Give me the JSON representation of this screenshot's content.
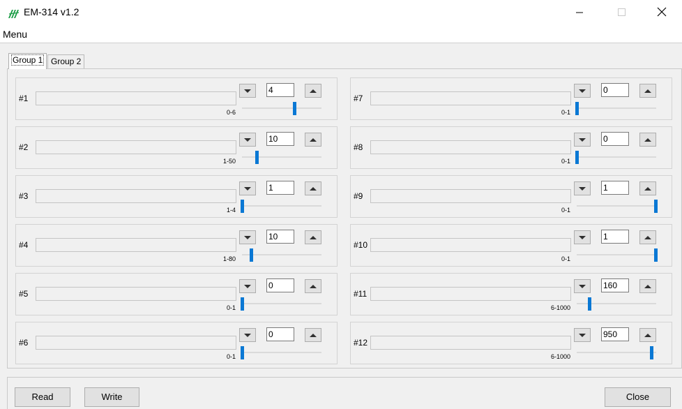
{
  "window": {
    "title": "EM-314 v1.2"
  },
  "menu": {
    "label": "Menu"
  },
  "tabs": [
    {
      "label": "Group 1",
      "active": true
    },
    {
      "label": "Group 2",
      "active": false
    }
  ],
  "groups_left": [
    {
      "label": "#1",
      "value": "4",
      "range": "0-6",
      "slider_fraction": 0.667
    },
    {
      "label": "#2",
      "value": "10",
      "range": "1-50",
      "slider_fraction": 0.184
    },
    {
      "label": "#3",
      "value": "1",
      "range": "1-4",
      "slider_fraction": 0.0
    },
    {
      "label": "#4",
      "value": "10",
      "range": "1-80",
      "slider_fraction": 0.114
    },
    {
      "label": "#5",
      "value": "0",
      "range": "0-1",
      "slider_fraction": 0.0
    },
    {
      "label": "#6",
      "value": "0",
      "range": "0-1",
      "slider_fraction": 0.0
    }
  ],
  "groups_right": [
    {
      "label": "#7",
      "value": "0",
      "range": "0-1",
      "slider_fraction": 0.0
    },
    {
      "label": "#8",
      "value": "0",
      "range": "0-1",
      "slider_fraction": 0.0
    },
    {
      "label": "#9",
      "value": "1",
      "range": "0-1",
      "slider_fraction": 1.0
    },
    {
      "label": "#10",
      "value": "1",
      "range": "0-1",
      "slider_fraction": 1.0
    },
    {
      "label": "#11",
      "value": "160",
      "range": "6-1000",
      "slider_fraction": 0.155
    },
    {
      "label": "#12",
      "value": "950",
      "range": "6-1000",
      "slider_fraction": 0.95
    }
  ],
  "buttons": {
    "read": "Read",
    "write": "Write",
    "close": "Close"
  },
  "colors": {
    "slider_thumb": "#0a78d4",
    "logo": "#1e9e48"
  }
}
